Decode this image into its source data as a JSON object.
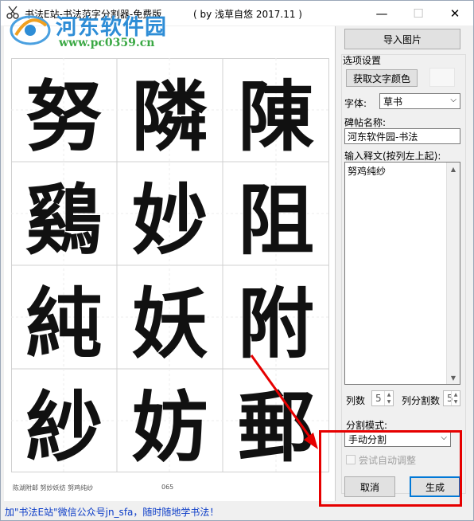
{
  "window": {
    "title": "书法E站-书法范字分割器-免费版",
    "title_info": "( by 浅草自悠    2017.11 )",
    "minimize": "—",
    "maximize": "☐",
    "close": "✕"
  },
  "watermark": {
    "name": "河东软件园",
    "url": "www.pc0359.cn"
  },
  "preview": {
    "cells": [
      "努",
      "隣",
      "陳",
      "鷄",
      "妙",
      "阻",
      "純",
      "妖",
      "附",
      "紗",
      "妨",
      "郵"
    ],
    "caption": "陈湖附邮  努妙妖纺  努鸡纯纱",
    "page_number": "065"
  },
  "panel": {
    "import_button": "导入图片",
    "options_label": "选项设置",
    "get_color_button": "获取文字颜色",
    "font_label": "字体:",
    "font_value": "草书",
    "title_label": "碑帖名称:",
    "title_value": "河东软件园-书法",
    "text_label": "输入释文(按列左上起):",
    "text_value": "努鸡纯纱",
    "cols_label": "列数",
    "cols_value": "5",
    "split_count_label": "列分割数",
    "split_count_value": "5",
    "split_mode_label": "分割模式:",
    "split_mode_value": "手动分割",
    "auto_adjust_label": "尝试自动调整",
    "cancel_button": "取消",
    "generate_button": "生成"
  },
  "status": {
    "text": "加\"书法E站\"微信公众号jn_sfa，随时随地学书法！"
  },
  "colors": {
    "accent": "#0078d7",
    "annotation": "#e60000",
    "status_link": "#0b3cc7"
  }
}
